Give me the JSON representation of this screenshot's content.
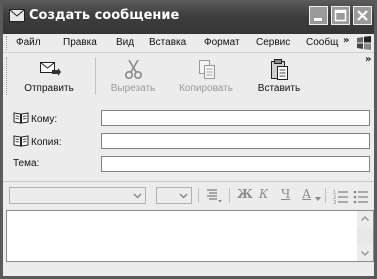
{
  "window": {
    "title": "Создать сообщение"
  },
  "menu": {
    "items": [
      "Файл",
      "Правка",
      "Вид",
      "Вставка",
      "Формат",
      "Сервис",
      "Сообщ"
    ],
    "more": "»"
  },
  "toolbar": {
    "more": "»",
    "buttons": [
      {
        "label": "Отправить",
        "icon": "send-icon",
        "enabled": true
      },
      {
        "label": "Вырезать",
        "icon": "scissors-icon",
        "enabled": false
      },
      {
        "label": "Копировать",
        "icon": "copy-icon",
        "enabled": false
      },
      {
        "label": "Вставить",
        "icon": "paste-icon",
        "enabled": true
      }
    ]
  },
  "headers": {
    "to_label": "Кому:",
    "to_value": "",
    "cc_label": "Копия:",
    "cc_value": "",
    "subject_label": "Тема:",
    "subject_value": ""
  },
  "format": {
    "font_name": "",
    "font_size": "",
    "bold": "Ж",
    "italic": "К",
    "underline": "Ч",
    "font_color": "А"
  },
  "message": {
    "body": ""
  }
}
